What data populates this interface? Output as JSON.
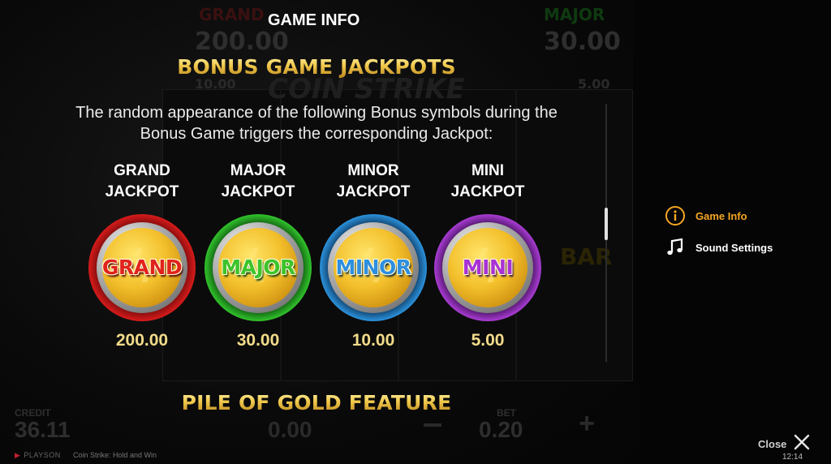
{
  "background": {
    "grand_title": "GRAND",
    "grand_value": "200.00",
    "major_title": "MAJOR",
    "major_value": "30.00",
    "minor_value": "10.00",
    "mini_value": "5.00",
    "logo_text": "COIN STRIKE",
    "bar_text": "BAR",
    "credit_label": "CREDIT",
    "credit_value": "36.11",
    "win_value": "0.00",
    "bet_label": "BET",
    "bet_value": "0.20",
    "plus_symbol": "+",
    "brand": "PLAYSON",
    "game_name": "Coin Strike: Hold and Win"
  },
  "panel": {
    "title": "GAME INFO",
    "bonus_heading": "BONUS GAME JACKPOTS",
    "description": "The random appearance of the following Bonus symbols during the Bonus Game triggers the corresponding Jackpot:",
    "next_heading": "PILE OF GOLD FEATURE"
  },
  "jackpots": [
    {
      "title": "GRAND JACKPOT",
      "coin_label": "GRAND",
      "value": "200.00",
      "ring_color": "#d41a1a",
      "text_color": "#e0231c"
    },
    {
      "title": "MAJOR JACKPOT",
      "coin_label": "MAJOR",
      "value": "30.00",
      "ring_color": "#2fbf2a",
      "text_color": "#3cc42b"
    },
    {
      "title": "MINOR JACKPOT",
      "coin_label": "MINOR",
      "value": "10.00",
      "ring_color": "#2a8fd8",
      "text_color": "#2d8fe0"
    },
    {
      "title": "MINI JACKPOT",
      "coin_label": "MINI",
      "value": "5.00",
      "ring_color": "#a63ad0",
      "text_color": "#a832d6"
    }
  ],
  "menu": {
    "items": [
      {
        "label": "Game Info",
        "icon": "info-icon",
        "active": true,
        "color": "#f5a623"
      },
      {
        "label": "Sound Settings",
        "icon": "music-note-icon",
        "active": false,
        "color": "#ffffff"
      }
    ]
  },
  "footer": {
    "close_label": "Close",
    "clock": "12:14"
  }
}
